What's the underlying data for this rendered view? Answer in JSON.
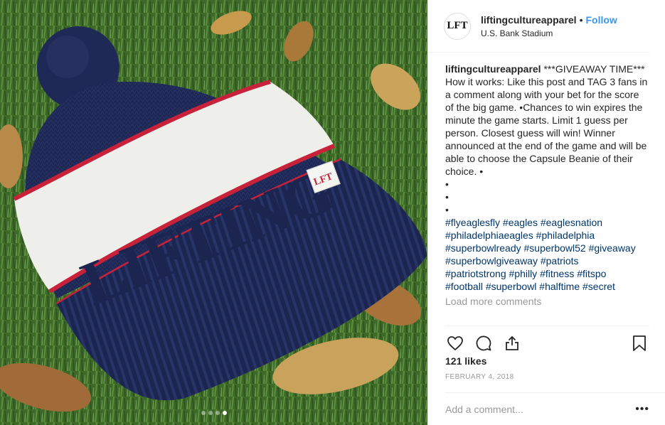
{
  "header": {
    "avatar_text": "LFT",
    "username": "liftingcultureapparel",
    "separator": "•",
    "follow_label": "Follow",
    "location": "U.S. Bank Stadium"
  },
  "photo": {
    "beanie_text": "LIFTING",
    "patch_text": "LFT",
    "carousel_dots": 4,
    "active_dot": 3
  },
  "caption": {
    "username": "liftingcultureapparel",
    "lines": [
      " ***GIVEAWAY TIME***",
      "How it works: Like this post and TAG 3 fans in a comment along with your bet for the score of the big game. •Chances to win expires the minute the game starts. Limit 1 guess per person. Closest guess will win! Winner announced at the end of the game and will be able to choose the Capsule Beanie of their choice. •",
      "•",
      "•",
      "•"
    ],
    "hashtag_lines": [
      "#flyeaglesfly #eagles #eaglesnation",
      "#philadelphiaeagles #philadelphia",
      "#superbowlready #superbowl52 #giveaway",
      "#superbowlgiveaway #patriots",
      "#patriotstrong #philly #fitness #fitspo",
      "#football #superbowl #halftime #secret"
    ]
  },
  "load_more": "Load more comments",
  "actions": {
    "like_icon": "heart-icon",
    "comment_icon": "comment-icon",
    "share_icon": "share-icon",
    "save_icon": "bookmark-icon"
  },
  "likes": "121 likes",
  "date": "FEBRUARY 4, 2018",
  "comment": {
    "placeholder": "Add a comment...",
    "more_label": "•••"
  }
}
